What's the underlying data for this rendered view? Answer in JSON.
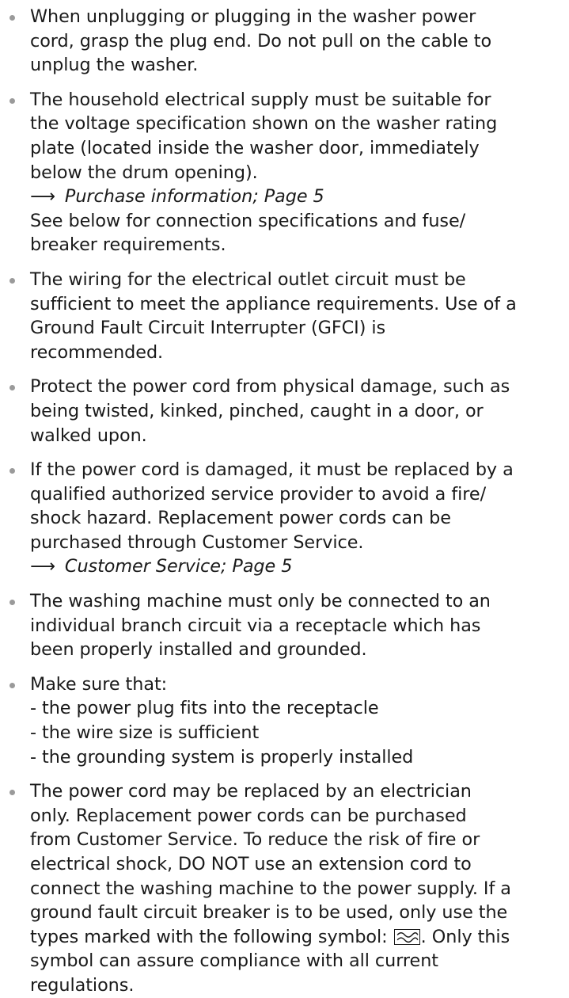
{
  "items": [
    {
      "lines": [
        "When unplugging or plugging in the washer power",
        "cord, grasp the plug end. Do not pull on the cable to",
        "unplug the washer."
      ]
    },
    {
      "lines": [
        "The household electrical supply must be suitable for",
        "the voltage specification shown on the washer rating",
        "plate (located inside the washer door, immediately",
        "below the drum opening)."
      ],
      "xref_arrow": "⟶",
      "xref": "Purchase information; Page 5",
      "after_lines": [
        "See below for connection specifications and fuse/",
        "breaker requirements."
      ]
    },
    {
      "lines": [
        "The wiring for the electrical outlet circuit must be",
        "sufficient to meet the appliance requirements. Use of a",
        "Ground Fault Circuit Interrupter (GFCI) is",
        "recommended."
      ]
    },
    {
      "lines": [
        "Protect the power cord from physical damage, such as",
        "being twisted, kinked, pinched, caught in a door, or",
        "walked upon."
      ]
    },
    {
      "lines": [
        "If the power cord is damaged, it must be replaced by a",
        "qualified authorized service provider to avoid a fire/",
        "shock hazard. Replacement power cords can be",
        "purchased through Customer Service."
      ],
      "xref_arrow": "⟶",
      "xref": "Customer Service; Page 5"
    },
    {
      "lines": [
        "The washing machine must only be connected to an",
        "individual branch circuit via a receptacle which has",
        "been properly installed and grounded."
      ]
    },
    {
      "lines": [
        "Make sure that:",
        "- the power plug fits into the receptacle",
        "- the wire size is sufficient",
        "- the grounding system is properly installed"
      ]
    },
    {
      "lines": [
        "The power cord may be replaced by an electrician",
        "only. Replacement power cords can be purchased",
        "from Customer Service. To reduce the risk of fire or",
        "electrical shock, DO NOT use an extension cord to",
        "connect the washing machine to the power supply. If a",
        "ground fault circuit breaker is to be used, only use the"
      ],
      "symbol_line_before": "types marked with the following symbol: ",
      "symbol_line_after": ". Only this",
      "after_lines": [
        "symbol can assure compliance with all current",
        "regulations."
      ]
    }
  ]
}
